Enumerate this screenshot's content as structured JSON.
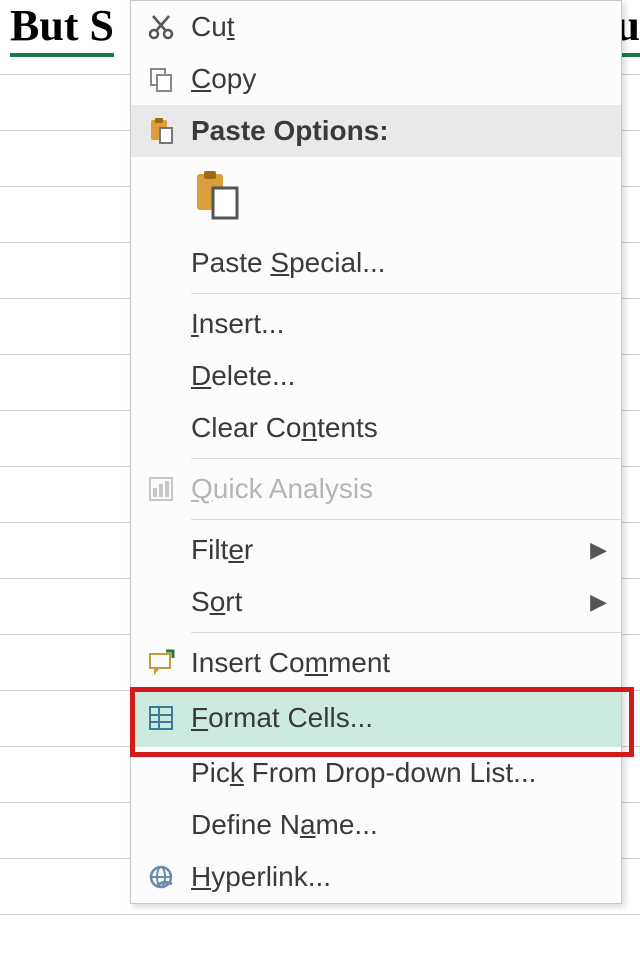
{
  "title_left": "But S",
  "title_right": "u",
  "menu": {
    "cut": "Cu<u>t</u>",
    "copy": "<u>C</u>opy",
    "paste_options": "Paste Options:",
    "paste_special": "Paste <u>S</u>pecial...",
    "insert": "<u>I</u>nsert...",
    "delete": "<u>D</u>elete...",
    "clear": "Clear Co<u>n</u>tents",
    "quick_analysis": "<u>Q</u>uick Analysis",
    "filter": "Filt<u>e</u>r",
    "sort": "S<u>o</u>rt",
    "insert_comment": "Insert Co<u>m</u>ment",
    "format_cells": "<u>F</u>ormat Cells...",
    "pick_list": "Pic<u>k</u> From Drop-down List...",
    "define_name": "Define N<u>a</u>me...",
    "hyperlink": "<u>H</u>yperlink..."
  }
}
